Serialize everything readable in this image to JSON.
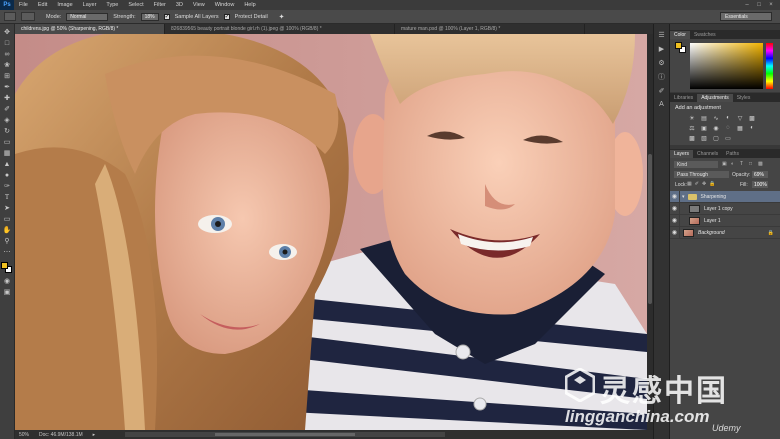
{
  "app": {
    "logo": "Ps",
    "menus": [
      "File",
      "Edit",
      "Image",
      "Layer",
      "Type",
      "Select",
      "Filter",
      "3D",
      "View",
      "Window",
      "Help"
    ]
  },
  "options": {
    "mode_label": "Mode:",
    "mode_value": "Normal",
    "strength_label": "Strength:",
    "strength_value": "18%",
    "sample_all_layers": "Sample All Layers",
    "protect_detail": "Protect Detail",
    "workspace": "Essentials"
  },
  "tabs": [
    {
      "label": "childrens.jpg @ 50% (Sharpening, RGB/8) *",
      "active": true
    },
    {
      "label": "826839565 beauty portrait blonde girl.rh (1).jpeg @ 100% (RGB/8) *",
      "active": false
    },
    {
      "label": "mature man.psd @ 100% (Layer 1, RGB/8) *",
      "active": false
    }
  ],
  "status": {
    "zoom": "50%",
    "doc": "Doc: 46.9M/138.1M"
  },
  "panels": {
    "color_tabs": [
      "Color",
      "Swatches"
    ],
    "adjust_tabs": [
      "Libraries",
      "Adjustments",
      "Styles"
    ],
    "adjust_title": "Add an adjustment",
    "layers_tabs": [
      "Layers",
      "Channels",
      "Paths"
    ],
    "kind": "Kind",
    "blend_mode": "Pass Through",
    "opacity_label": "Opacity:",
    "opacity_value": "69%",
    "lock_label": "Lock:",
    "fill_label": "Fill:",
    "fill_value": "100%",
    "layers": [
      {
        "name": "Sharpening",
        "type": "group",
        "selected": true
      },
      {
        "name": "Layer 1 copy",
        "type": "gray",
        "selected": false
      },
      {
        "name": "Layer 1",
        "type": "photo",
        "selected": false
      },
      {
        "name": "Background",
        "type": "photo",
        "selected": false,
        "italic": true,
        "locked": true
      }
    ]
  },
  "watermark": {
    "chinese": "灵感中国",
    "site": "lingganchina.com",
    "udemy": "Udemy"
  },
  "colors": {
    "foreground": "#f0c020",
    "background": "#ffffff",
    "selected_layer": "#5f6f87"
  }
}
